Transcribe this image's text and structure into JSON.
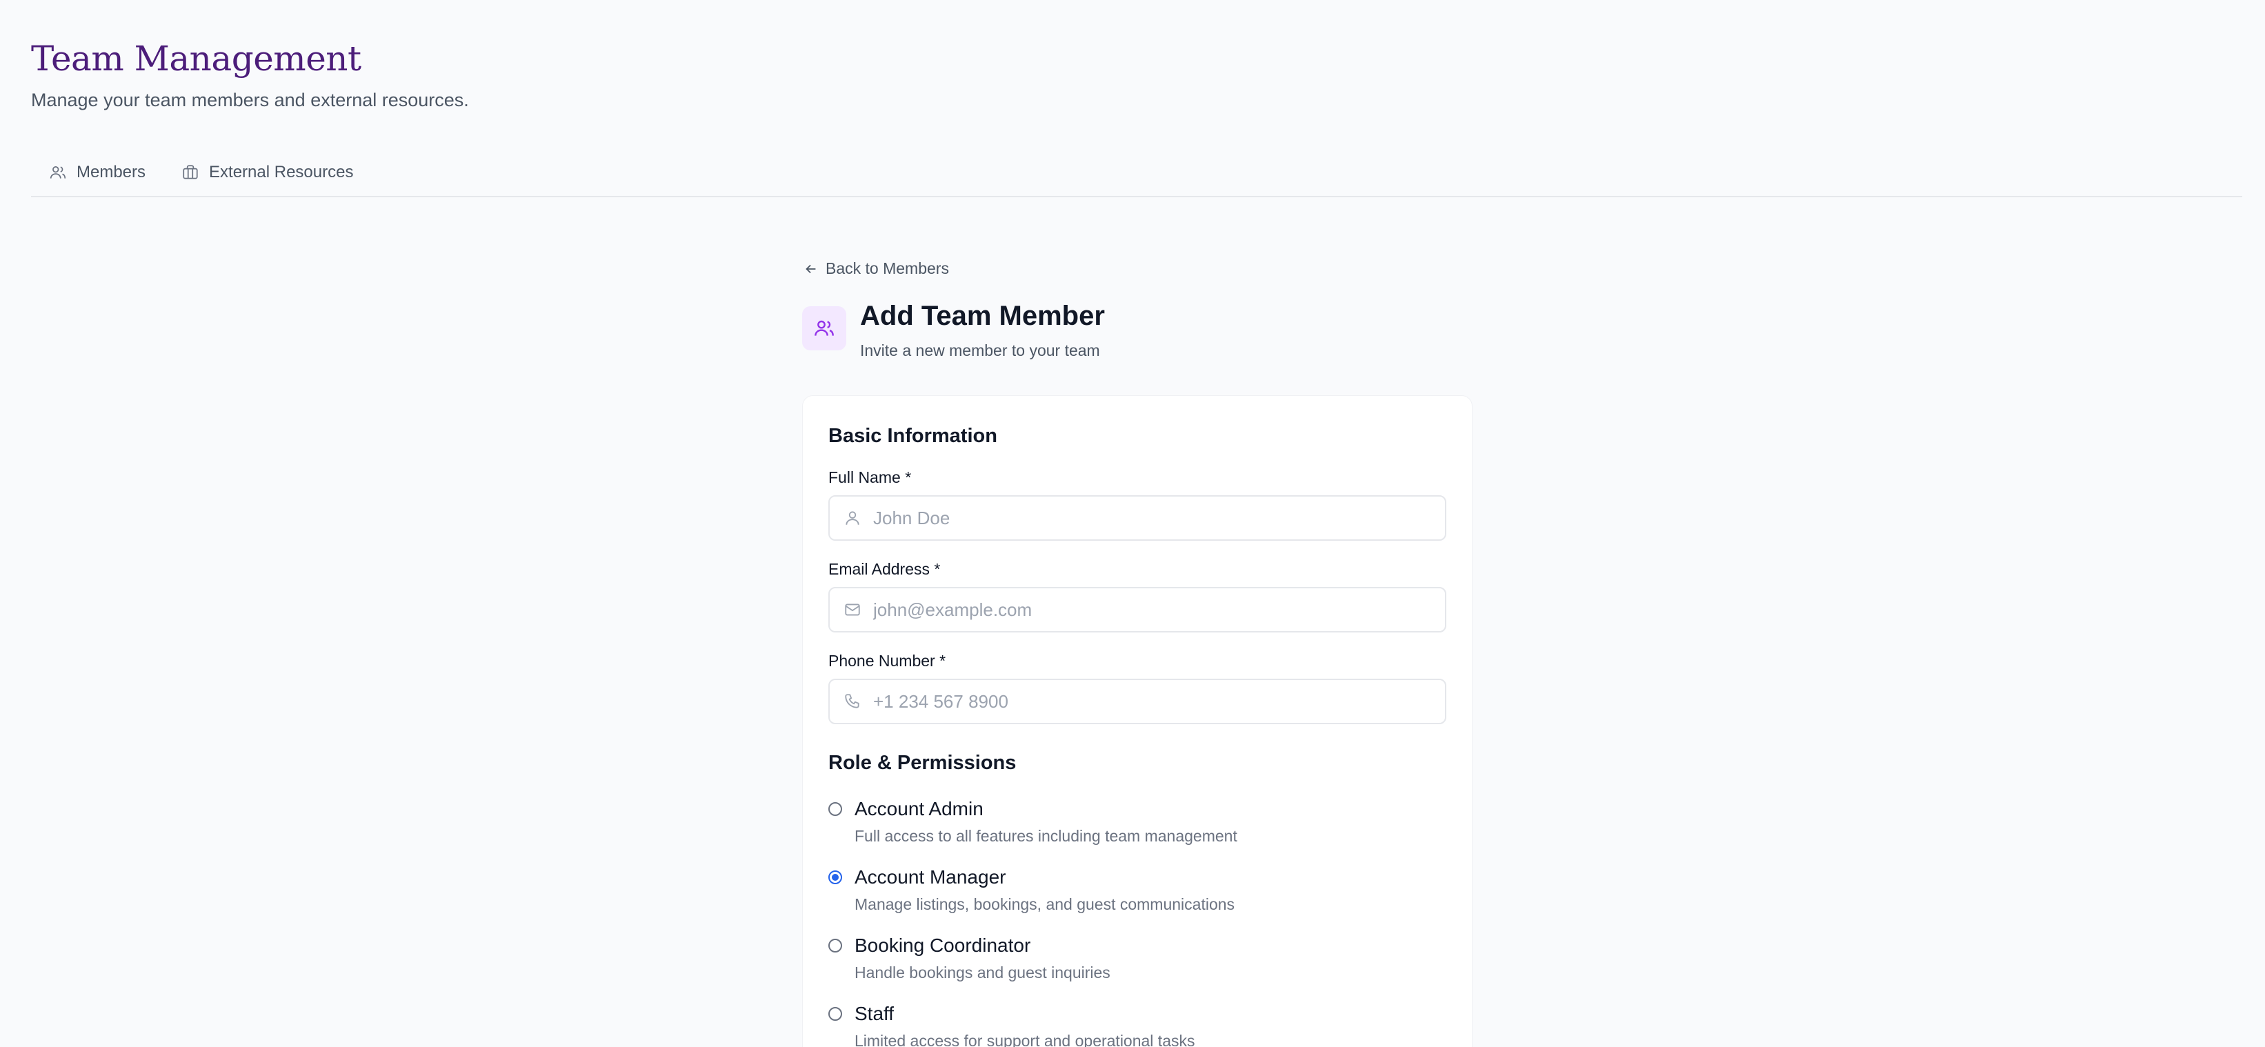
{
  "header": {
    "title": "Team Management",
    "subtitle": "Manage your team members and external resources."
  },
  "tabs": [
    {
      "label": "Members",
      "icon": "users-icon"
    },
    {
      "label": "External Resources",
      "icon": "briefcase-icon"
    }
  ],
  "back_link": {
    "label": "Back to Members",
    "icon": "arrow-left-icon"
  },
  "form": {
    "title": "Add Team Member",
    "subtitle": "Invite a new member to your team",
    "icon": "users-icon",
    "basic_section": "Basic Information",
    "fields": {
      "full_name": {
        "label": "Full Name *",
        "placeholder": "John Doe",
        "icon": "user-icon"
      },
      "email": {
        "label": "Email Address *",
        "placeholder": "john@example.com",
        "icon": "mail-icon"
      },
      "phone": {
        "label": "Phone Number *",
        "placeholder": "+1 234 567 8900",
        "icon": "phone-icon"
      }
    },
    "role_section": "Role & Permissions",
    "roles": [
      {
        "name": "Account Admin",
        "desc": "Full access to all features including team management",
        "selected": false
      },
      {
        "name": "Account Manager",
        "desc": "Manage listings, bookings, and guest communications",
        "selected": true
      },
      {
        "name": "Booking Coordinator",
        "desc": "Handle bookings and guest inquiries",
        "selected": false
      },
      {
        "name": "Staff",
        "desc": "Limited access for support and operational tasks",
        "selected": false
      }
    ]
  },
  "colors": {
    "title": "#4c1d7a",
    "accent": "#9333ea",
    "radio_selected": "#2563eb",
    "background": "#f9fafc"
  }
}
